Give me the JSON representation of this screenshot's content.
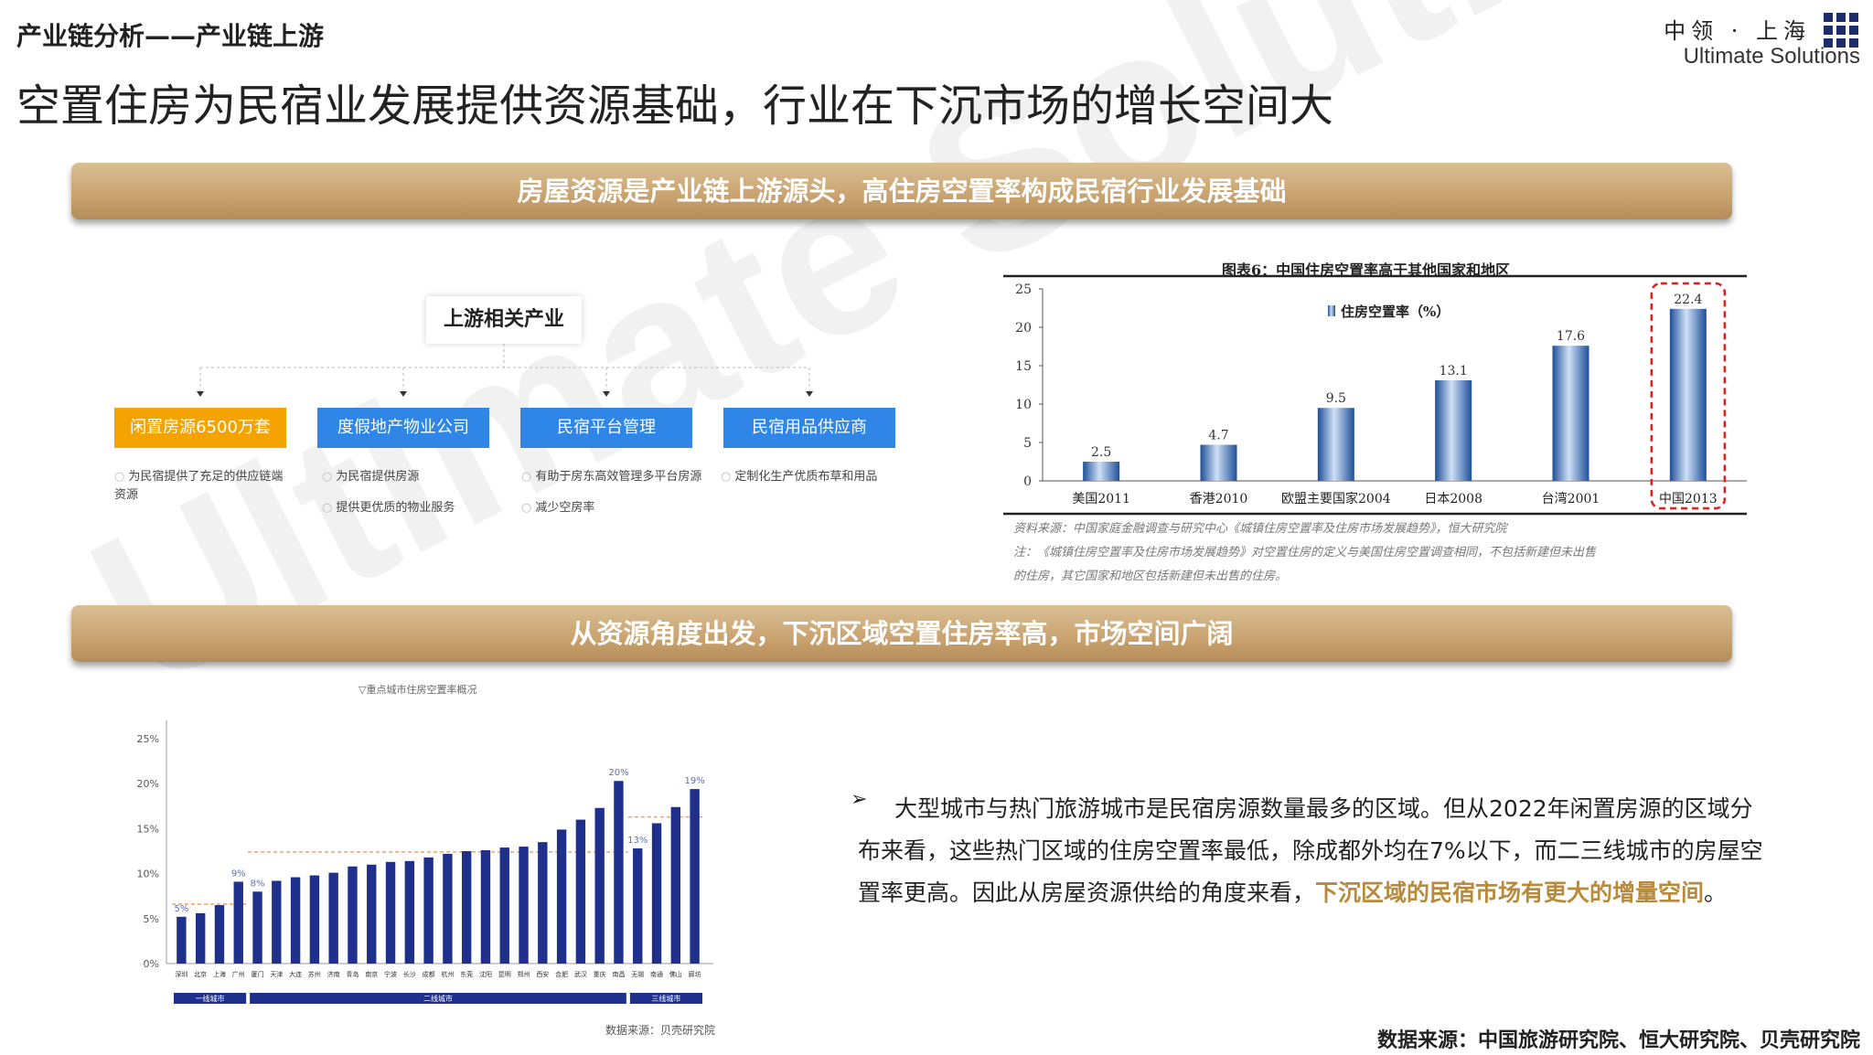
{
  "header": {
    "section_label": "产业链分析——产业链上游",
    "title": "空置住房为民宿业发展提供资源基础，行业在下沉市场的增长空间大",
    "logo_cn": "中领 · 上海",
    "logo_en": "Ultimate Solutions",
    "logo_color": "#1c2d6b"
  },
  "watermark": "Ultimate Solutions",
  "banner1": "房屋资源是产业链上游源头，高住房空置率构成民宿行业发展基础",
  "banner2": "从资源角度出发，下沉区域空置住房率高，市场空间广阔",
  "diagram": {
    "root": "上游相关产业",
    "categories": [
      {
        "label": "闲置房源6500万套",
        "color": "#f5a300",
        "notes": [
          "为民宿提供了充足的供应链端资源"
        ]
      },
      {
        "label": "度假地产物业公司",
        "color": "#2f86e6",
        "notes": [
          "为民宿提供房源",
          "提供更优质的物业服务"
        ]
      },
      {
        "label": "民宿平台管理",
        "color": "#2f86e6",
        "notes": [
          "有助于房东高效管理多平台房源",
          "减少空房率"
        ]
      },
      {
        "label": "民宿用品供应商",
        "color": "#2f86e6",
        "notes": [
          "定制化生产优质布草和用品"
        ]
      }
    ]
  },
  "chart_data": [
    {
      "type": "bar",
      "title": "图表6：中国住房空置率高于其他国家和地区",
      "legend": "住房空置率（%）",
      "categories": [
        "美国2011",
        "香港2010",
        "欧盟主要国家2004",
        "日本2008",
        "台湾2001",
        "中国2013"
      ],
      "values": [
        2.5,
        4.7,
        9.5,
        13.1,
        17.6,
        22.4
      ],
      "ylim": [
        0,
        25
      ],
      "yticks": [
        "0",
        "5",
        "10",
        "15",
        "20",
        "25"
      ],
      "highlight": "中国2013",
      "bar_color": "#2a67b3",
      "source_lines": [
        "资料来源：中国家庭金融调查与研究中心《城镇住房空置率及住房市场发展趋势》，恒大研究院",
        "注：《城镇住房空置率及住房市场发展趋势》对空置住房的定义与美国住房空置调查相同，不包括新建但未出售",
        "的住房，其它国家和地区包括新建但未出售的住房。"
      ]
    },
    {
      "type": "bar",
      "title": "▽重点城市住房空置率概况",
      "categories": [
        "深圳",
        "北京",
        "上海",
        "广州",
        "厦门",
        "天津",
        "大连",
        "苏州",
        "济南",
        "青岛",
        "南京",
        "宁波",
        "长沙",
        "成都",
        "杭州",
        "东莞",
        "沈阳",
        "昆明",
        "郑州",
        "西安",
        "合肥",
        "武汉",
        "重庆",
        "南昌",
        "无锡",
        "南通",
        "佛山",
        "廊坊"
      ],
      "values": [
        5.2,
        5.6,
        6.5,
        9.1,
        8.0,
        9.2,
        9.6,
        9.8,
        10.1,
        10.8,
        11.0,
        11.3,
        11.4,
        11.8,
        12.2,
        12.5,
        12.6,
        12.9,
        13.0,
        13.5,
        14.9,
        16.0,
        17.3,
        20.3,
        12.8,
        15.6,
        17.4,
        19.4
      ],
      "value_labels": {
        "深圳": "5%",
        "广州": "9%",
        "厦门": "8%",
        "南昌": "20%",
        "无锡": "13%",
        "廊坊": "19%"
      },
      "yticks": [
        "0%",
        "5%",
        "10%",
        "15%",
        "20%",
        "25%"
      ],
      "ylim": [
        0,
        25
      ],
      "groups": [
        {
          "label": "一线城市",
          "count": 4
        },
        {
          "label": "二线城市",
          "count": 20
        },
        {
          "label": "三线城市",
          "count": 4
        }
      ],
      "bar_color": "#1f2f8c",
      "avg_line_color": "#f0a060",
      "source": "数据来源：贝壳研究院"
    }
  ],
  "body": {
    "bullet": "➢",
    "text_plain": "大型城市与热门旅游城市是民宿房源数量最多的区域。但从2022年闲置房源的区域分布来看，这些热门区域的住房空置率最低，除成都外均在7%以下，而二三线城市的房屋空置率更高。因此从房屋资源供给的角度来看，",
    "text_highlight": "下沉区域的民宿市场有更大的增量空间",
    "text_end": "。",
    "highlight_color": "#b88a3b"
  },
  "footer_source": "数据来源：中国旅游研究院、恒大研究院、贝壳研究院"
}
